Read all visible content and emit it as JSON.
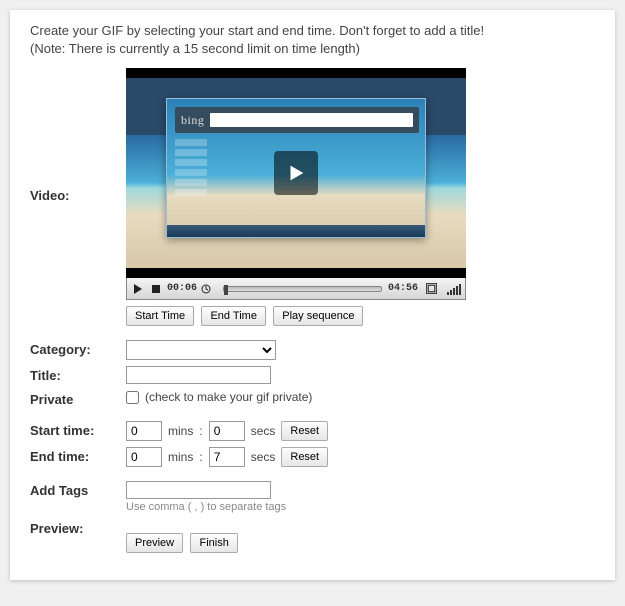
{
  "instructions": {
    "line1": "Create your GIF by selecting your start and end time. Don't forget to add a title!",
    "line2": "(Note: There is currently a 15 second limit on time length)"
  },
  "labels": {
    "video": "Video:",
    "category": "Category:",
    "title": "Title:",
    "private": "Private",
    "start_time": "Start time:",
    "end_time": "End time:",
    "add_tags": "Add Tags",
    "preview": "Preview:"
  },
  "video": {
    "current_time": "00:06",
    "total_time": "04:56",
    "bing_label": "bing"
  },
  "buttons": {
    "start_time": "Start Time",
    "end_time": "End Time",
    "play_sequence": "Play sequence",
    "reset": "Reset",
    "preview": "Preview",
    "finish": "Finish"
  },
  "fields": {
    "category_value": "",
    "title_value": "",
    "private_checked": false,
    "private_hint": "(check to make your gif private)",
    "start_mins": "0",
    "start_secs": "0",
    "end_mins": "0",
    "end_secs": "7",
    "tags_value": "",
    "tags_hint": "Use comma ( , ) to separate tags",
    "mins_label": "mins",
    "secs_label": "secs",
    "colon": ":"
  }
}
